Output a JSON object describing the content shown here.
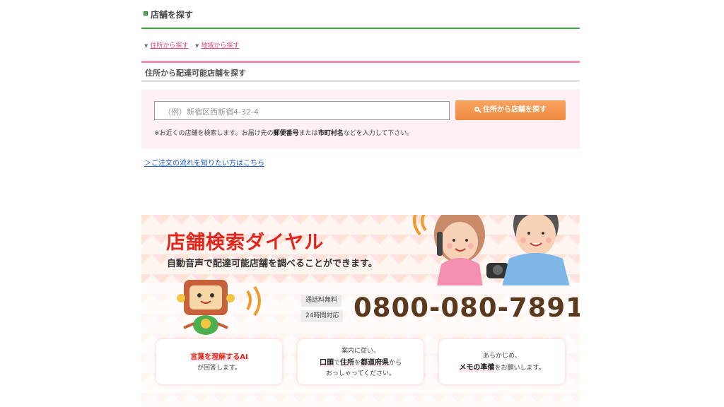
{
  "section": {
    "title": "店舗を探す"
  },
  "links": [
    {
      "label": "住所から探す"
    },
    {
      "label": "地域から探す"
    }
  ],
  "subsection": {
    "title": "住所から配達可能店舗を探す"
  },
  "search": {
    "placeholder": "（例）新宿区西新宿4-32-4",
    "button_label": "住所から店舗を探す",
    "note_prefix": "※お近くの店舗を検索します。お届け先の",
    "note_bold1": "郵便番号",
    "note_mid": "または",
    "note_bold2": "市町村名",
    "note_suffix": "などを入力して下さい。"
  },
  "flow_link": {
    "label": "＞ご注文の流れを知りたい方はこちら"
  },
  "banner": {
    "title": "店舗検索ダイヤル",
    "subtitle": "自動音声で配達可能店舗を調べることができます。",
    "tag_free": "通話料無料",
    "tag_hours": "24時間対応",
    "phone": "0800-080-7891",
    "cards": [
      {
        "line1": "言葉を理解するAI",
        "line2": "が回答します。"
      },
      {
        "line1": "案内に従い、",
        "line2_b1": "口頭",
        "line2_t1": "で",
        "line2_b2": "住所",
        "line2_t2": "を",
        "line2_b3": "都道府県",
        "line2_t3": "から",
        "line3": "おっしゃってください。"
      },
      {
        "line1": "あらかじめ、",
        "line2_b": "メモの準備",
        "line2_t": "をお願いします。"
      }
    ],
    "colors": {
      "title": "#e2261c",
      "phone": "#5a3a1e",
      "button": "#f08a40",
      "accent_green": "#3aa83a",
      "accent_pink": "#f08fb3"
    }
  }
}
